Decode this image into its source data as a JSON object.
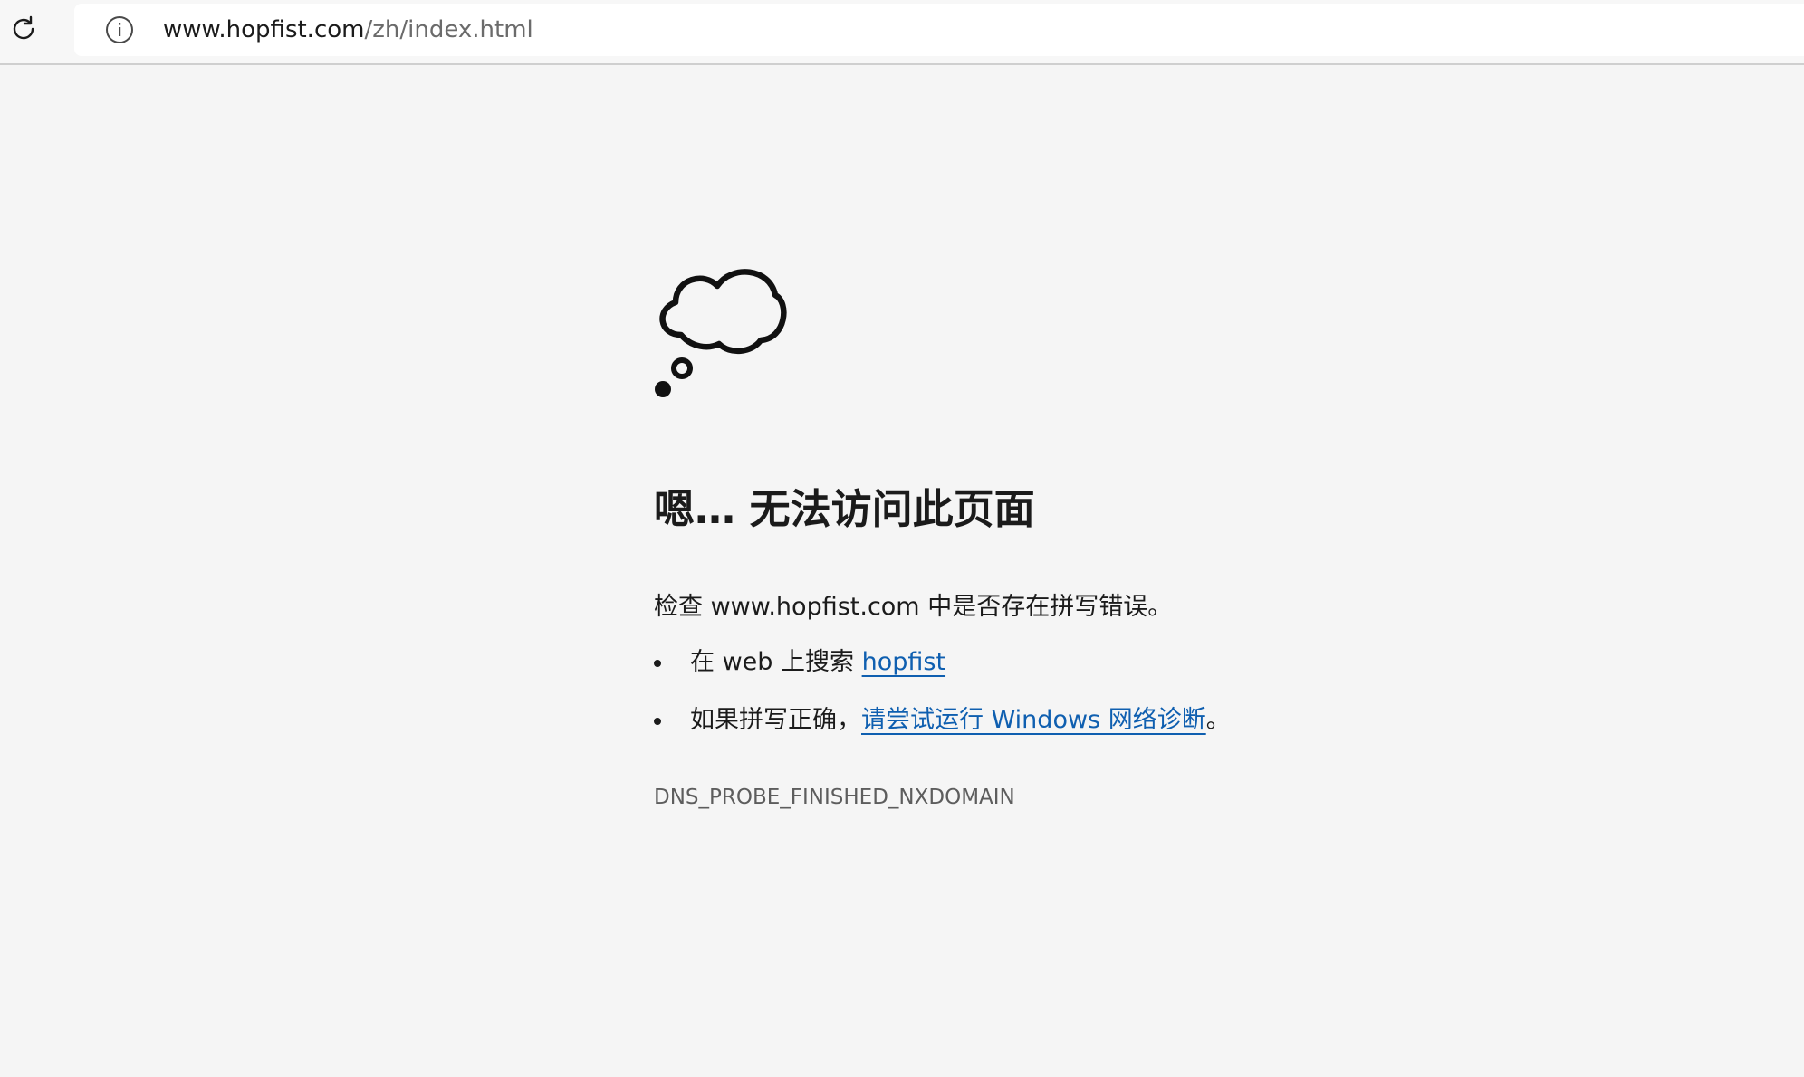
{
  "browser": {
    "url_host": "www.hopfist.com",
    "url_path": "/zh/index.html",
    "icons": {
      "reload": "reload-icon",
      "site_info": "info-icon"
    }
  },
  "error_page": {
    "illustration": "thought-cloud-icon",
    "heading": "嗯… 无法访问此页面",
    "check_text": "检查 www.hopfist.com 中是否存在拼写错误。",
    "suggestions": [
      {
        "prefix": "在 web 上搜索 ",
        "link": "hopfist",
        "suffix": ""
      },
      {
        "prefix": "如果拼写正确，",
        "link": "请尝试运行 Windows 网络诊断",
        "suffix": "。"
      }
    ],
    "error_code": "DNS_PROBE_FINISHED_NXDOMAIN"
  },
  "colors": {
    "background": "#f5f5f5",
    "link": "#0f5fb0",
    "text": "#1b1b1b",
    "muted": "#5d5d5d"
  }
}
